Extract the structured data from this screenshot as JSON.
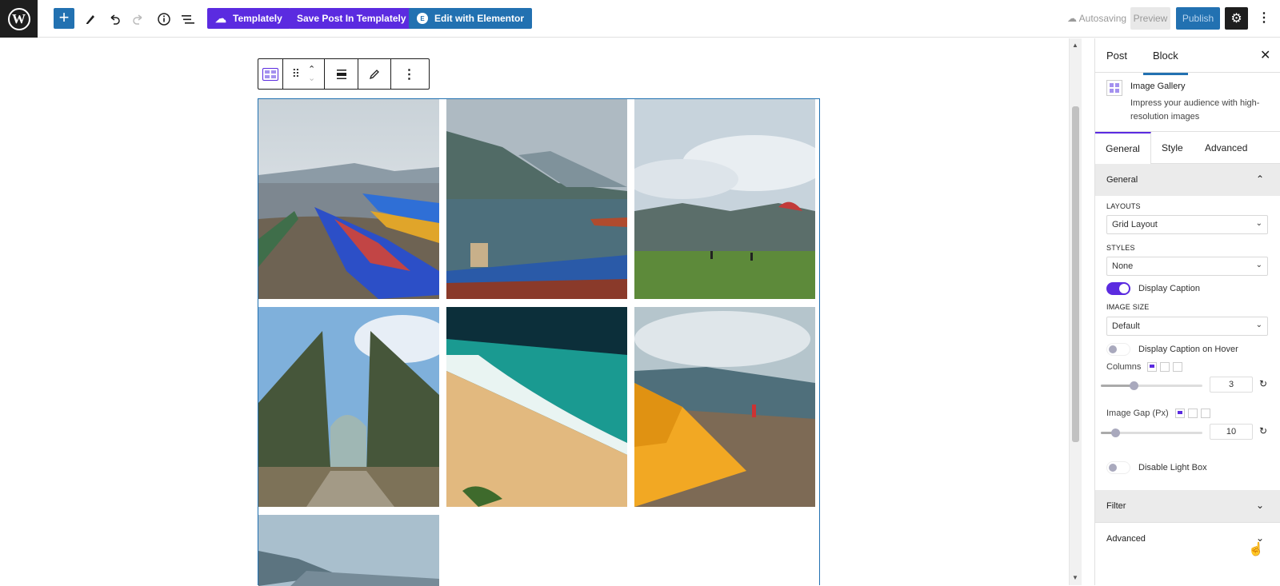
{
  "topbar": {
    "templately_label": "Templately",
    "save_templately_label": "Save Post In Templately",
    "elementor_label": "Edit with Elementor",
    "autosaving_label": "Autosaving",
    "preview_label": "Preview",
    "publish_label": "Publish"
  },
  "sidebar": {
    "tabs": {
      "post": "Post",
      "block": "Block"
    },
    "block_title": "Image Gallery",
    "block_desc": "Impress your audience with high-resolution images",
    "inner_tabs": {
      "general": "General",
      "style": "Style",
      "advanced": "Advanced"
    },
    "general_panel_title": "General",
    "layouts_label": "LAYOUTS",
    "layouts_value": "Grid Layout",
    "styles_label": "STYLES",
    "styles_value": "None",
    "display_caption_label": "Display Caption",
    "display_caption_on": true,
    "image_size_label": "IMAGE SIZE",
    "image_size_value": "Default",
    "caption_hover_label": "Display Caption on Hover",
    "caption_hover_on": false,
    "columns_label": "Columns",
    "columns_value": "3",
    "columns_slider_fraction": 0.3,
    "image_gap_label": "Image Gap (Px)",
    "image_gap_value": "10",
    "image_gap_slider_fraction": 0.1,
    "disable_lightbox_label": "Disable Light Box",
    "disable_lightbox_on": false,
    "filter_panel_title": "Filter",
    "advanced_panel_title": "Advanced"
  },
  "gallery": {
    "images": [
      {
        "name": "lake-boats"
      },
      {
        "name": "lake-fisherman"
      },
      {
        "name": "paragliding-field"
      },
      {
        "name": "temple-gate"
      },
      {
        "name": "beach-aerial"
      },
      {
        "name": "yellow-tent"
      },
      {
        "name": "lake-mountain"
      }
    ]
  },
  "colors": {
    "accent_purple": "#5b2be0",
    "accent_blue": "#2271b1"
  }
}
